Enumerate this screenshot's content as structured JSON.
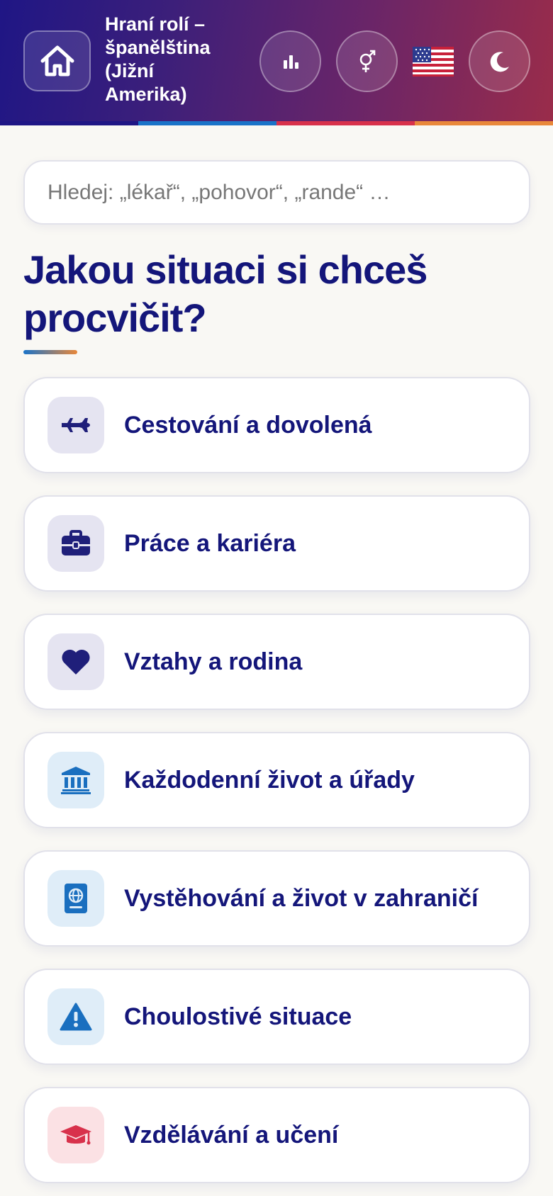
{
  "header": {
    "title": "Hraní rolí – španělština (Jižní Amerika)",
    "home_icon": "home-icon",
    "stats_icon": "bar-chart-icon",
    "gender_icon": "gender-icon",
    "flag": "🇺🇸",
    "theme_icon": "moon-icon",
    "stripe_colors": [
      "#1f1685",
      "#1a73c8",
      "#d8314b",
      "#e9883a"
    ]
  },
  "search": {
    "placeholder": "Hledej: „lékař“, „pohovor“, „rande“ …",
    "value": ""
  },
  "main": {
    "heading": "Jakou situaci si chceš procvičit?",
    "categories": [
      {
        "label": "Cestování a dovolená",
        "icon": "airplane-icon",
        "icon_bg": "#e5e4f1",
        "icon_color": "#1f1f7a"
      },
      {
        "label": "Práce a kariéra",
        "icon": "briefcase-icon",
        "icon_bg": "#e5e4f1",
        "icon_color": "#1f1f7a"
      },
      {
        "label": "Vztahy a rodina",
        "icon": "heart-icon",
        "icon_bg": "#e5e4f1",
        "icon_color": "#1f1f7a"
      },
      {
        "label": "Každodenní život a úřady",
        "icon": "bank-icon",
        "icon_bg": "#dfedf8",
        "icon_color": "#1a6fbf"
      },
      {
        "label": "Vystěhování a život v zahraničí",
        "icon": "passport-icon",
        "icon_bg": "#dfedf8",
        "icon_color": "#1a6fbf"
      },
      {
        "label": "Choulostivé situace",
        "icon": "warning-icon",
        "icon_bg": "#dfedf8",
        "icon_color": "#1a6fbf"
      },
      {
        "label": "Vzdělávání a učení",
        "icon": "graduation-cap-icon",
        "icon_bg": "#fbe1e4",
        "icon_color": "#d8314b"
      }
    ]
  }
}
